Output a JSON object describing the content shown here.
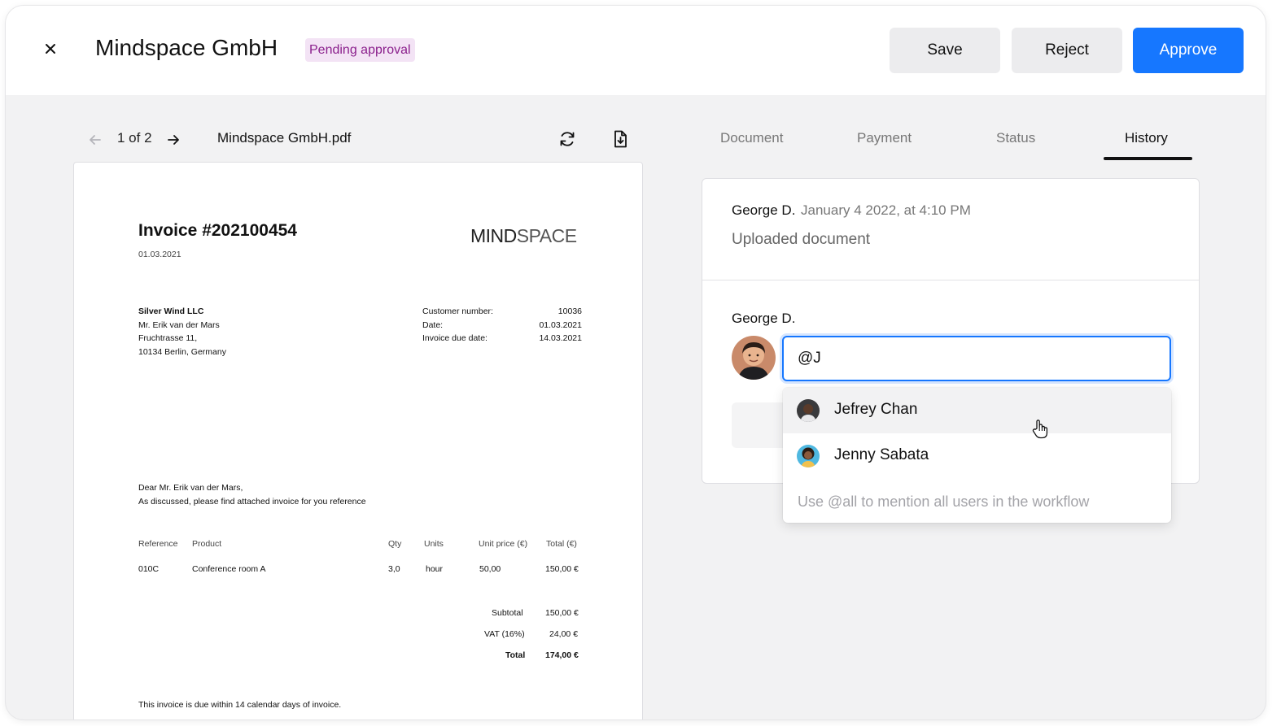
{
  "header": {
    "title": "Mindspace GmbH",
    "status_badge": "Pending approval",
    "save_label": "Save",
    "reject_label": "Reject",
    "approve_label": "Approve"
  },
  "viewer": {
    "page_indicator": "1 of 2",
    "filename": "Mindspace GmbH.pdf"
  },
  "invoice": {
    "title": "Invoice #202100454",
    "date": "01.03.2021",
    "logo_bold": "MIND",
    "logo_thin": "SPACE",
    "recipient": {
      "company": "Silver Wind LLC",
      "contact": "Mr. Erik van der Mars",
      "street": "Fruchtrasse 11,",
      "city": "10134 Berlin, Germany"
    },
    "meta": [
      {
        "label": "Customer number:",
        "value": "10036"
      },
      {
        "label": "Date:",
        "value": "01.03.2021"
      },
      {
        "label": "Invoice due date:",
        "value": "14.03.2021"
      }
    ],
    "greeting": "Dear Mr. Erik van der Mars,",
    "body": "As discussed, please find attached invoice for you reference",
    "columns": {
      "reference": "Reference",
      "product": "Product",
      "qty": "Qty",
      "units": "Units",
      "unit_price": "Unit price (€)",
      "total": "Total (€)"
    },
    "line": {
      "reference": "010C",
      "product": "Conference room A",
      "qty": "3,0",
      "units": "hour",
      "unit_price": "50,00",
      "total": "150,00 €"
    },
    "subtotal_label": "Subtotal",
    "subtotal_value": "150,00 €",
    "vat_label": "VAT (16%)",
    "vat_value": "24,00 €",
    "total_label": "Total",
    "total_value": "174,00 €",
    "footer": "This invoice is due within 14 calendar days of invoice."
  },
  "tabs": [
    {
      "label": "Document"
    },
    {
      "label": "Payment"
    },
    {
      "label": "Status"
    },
    {
      "label": "History",
      "active": true
    }
  ],
  "history": {
    "entry_author": "George D.",
    "entry_timestamp": "January 4 2022, at 4:10 PM",
    "entry_action": "Uploaded document",
    "comment_author": "George D.",
    "comment_value": "@J"
  },
  "mentions": {
    "users": [
      {
        "name": "Jefrey Chan"
      },
      {
        "name": "Jenny Sabata"
      }
    ],
    "hint": "Use @all to mention all users in the workflow"
  },
  "colors": {
    "accent": "#1677ff",
    "badge_bg": "#f3e3f5",
    "badge_text": "#8a1f8c"
  }
}
